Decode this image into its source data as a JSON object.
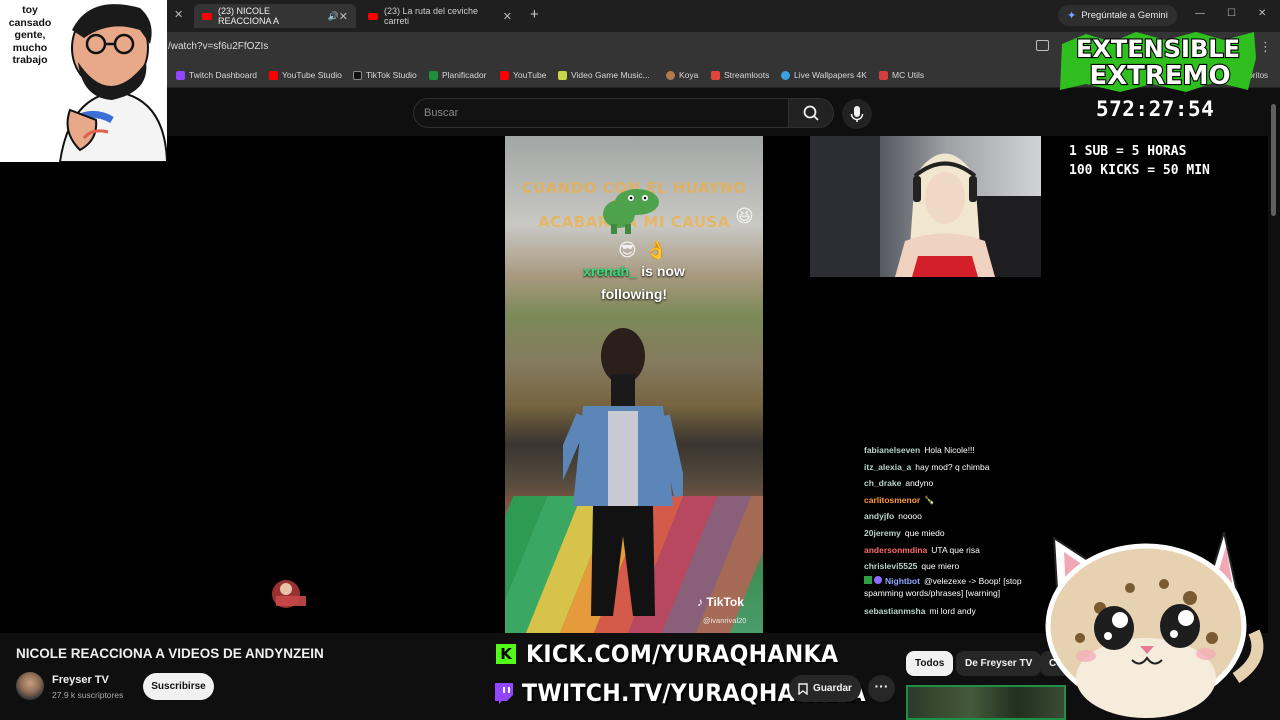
{
  "browser": {
    "tabs": [
      {
        "title": "(23) NICOLE REACCIONA A",
        "active": true
      },
      {
        "title": "(23) La ruta del ceviche carreti",
        "active": false
      }
    ],
    "gemini_button": "Pregúntale a Gemini",
    "url": "/watch?v=sf6u2FfOZIs",
    "bookmarks": [
      {
        "label": "Twitch Dashboard",
        "color": "#9146ff"
      },
      {
        "label": "YouTube Studio",
        "color": "#ff0000"
      },
      {
        "label": "TikTok Studio",
        "color": "#111111"
      },
      {
        "label": "Planificador",
        "color": "#1e8e3e"
      },
      {
        "label": "YouTube",
        "color": "#ff0000"
      },
      {
        "label": "Video Game Music...",
        "color": "#c9d64a"
      },
      {
        "label": "Koya",
        "color": "#b07a4a"
      },
      {
        "label": "Streamloots",
        "color": "#e0453a"
      },
      {
        "label": "Live Wallpapers 4K",
        "color": "#3aa0e0"
      },
      {
        "label": "MC Utils",
        "color": "#d04040"
      }
    ],
    "bookmarks_more": "avoritos"
  },
  "youtube": {
    "search_placeholder": "Buscar",
    "video_title": "NICOLE REACCIONA A VIDEOS DE ANDYNZEIN",
    "channel_name": "Freyser TV",
    "subscribers": "27.9 k suscriptores",
    "subscribe_label": "Suscribirse",
    "save_label": "Guardar",
    "chips": [
      "Todos",
      "De Freyser TV",
      "Con"
    ]
  },
  "video": {
    "tiktok_caption_1": "CUANDO CON EL HUAYNO PARA",
    "tiktok_caption_2": "ACABAR LA        MI CAUSA",
    "follow_user": "xrenah_",
    "follow_text": "is now",
    "follow_line2": "following!",
    "tiktok_logo": "TikTok",
    "tiktok_user": "@ivanrival20",
    "chat": [
      {
        "user": "fabianelseven",
        "color": "#b7d4c8",
        "msg": "Hola Nicole!!!"
      },
      {
        "user": "itz_alexia_a",
        "color": "#b7d4c8",
        "msg": "hay mod? q chimba"
      },
      {
        "user": "ch_drake",
        "color": "#b7d4c8",
        "msg": "andyno"
      },
      {
        "user": "carlitosmenor",
        "color": "#ff9a3c",
        "msg": "🍾"
      },
      {
        "user": "andyjfo",
        "color": "#b7d4c8",
        "msg": "noooo"
      },
      {
        "user": "20jeremy",
        "color": "#b7d4c8",
        "msg": "que miedo"
      },
      {
        "user": "andersonmdina",
        "color": "#ff6b6b",
        "msg": "UTA que risa"
      },
      {
        "user": "chrislevi5525",
        "color": "#b7d4c8",
        "msg": "que miero"
      },
      {
        "user": "Nightbot",
        "color": "#8ea9ff",
        "msg": "@velezexe -> Boop! [stop spamming words/phrases] [warning]"
      },
      {
        "user": "sebastianmsha",
        "color": "#b7d4c8",
        "msg": "mi lord andy"
      }
    ]
  },
  "overlay": {
    "sticker_text": "toy\ncansado\ngente,\nmucho\ntrabajo",
    "banner_line1": "EXTENSIBLE",
    "banner_line2": "EXTREMO",
    "timer": "572:27:54",
    "rules": "1 SUB = 5 HORAS\n100 KICKS = 50 MIN",
    "kick_url": "KICK.COM/YURAQHANKA",
    "twitch_url": "TWITCH.TV/YURAQHANKAA",
    "accent_green": "#53fc18",
    "twitch_purple": "#9146ff"
  }
}
